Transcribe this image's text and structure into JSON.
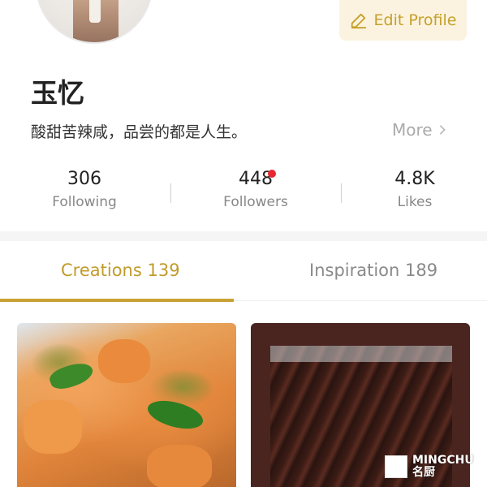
{
  "profile": {
    "username": "玉忆",
    "bio": "酸甜苦辣咸，品尝的都是人生。",
    "more_label": "More",
    "edit_label": "Edit Profile"
  },
  "stats": [
    {
      "value": "306",
      "label": "Following"
    },
    {
      "value": "448",
      "label": "Followers",
      "has_notification_dot": true
    },
    {
      "value": "4.8K",
      "label": "Likes"
    }
  ],
  "tabs": [
    {
      "label": "Creations 139",
      "active": true
    },
    {
      "label": "Inspiration 189",
      "active": false
    }
  ],
  "watermark": {
    "line1": "MINGCHU",
    "line2": "名厨"
  },
  "colors": {
    "accent": "#c8a234",
    "edit_button_bg": "#fbf3df",
    "notification_dot": "#e8272e",
    "muted_text": "#888888"
  },
  "icons": {
    "edit": "pencil-icon",
    "more": "chevron-right-icon"
  }
}
